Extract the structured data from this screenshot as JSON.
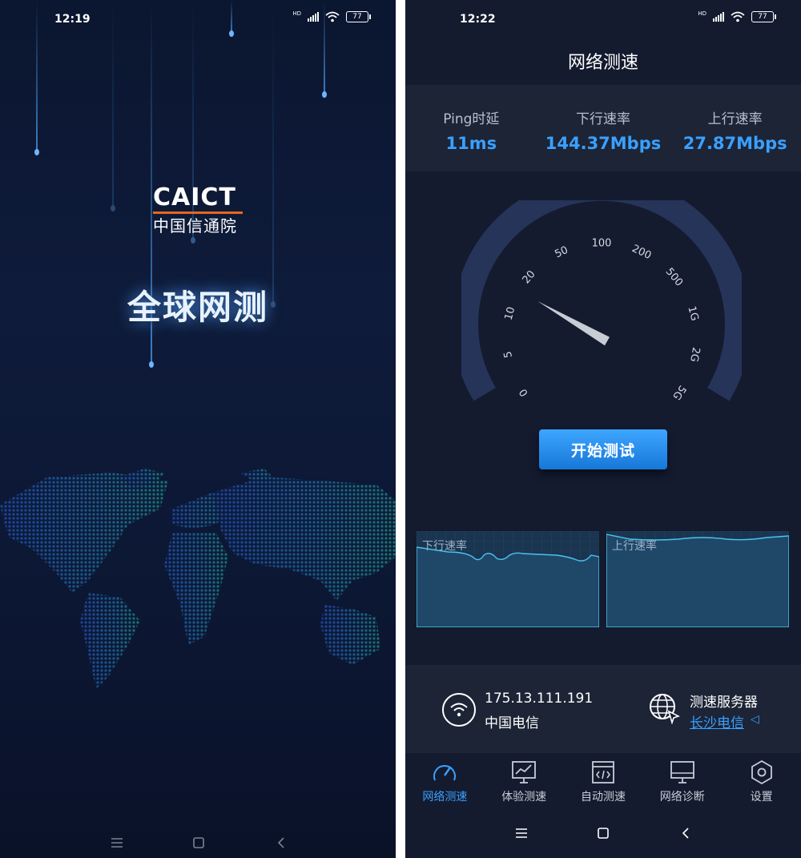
{
  "left": {
    "status": {
      "time": "12:19",
      "battery": "77",
      "hd": "HD"
    },
    "logo": {
      "en": "CAICT",
      "cn": "中国信通院"
    },
    "title": "全球网测"
  },
  "right": {
    "status": {
      "time": "12:22",
      "battery": "77",
      "hd": "HD"
    },
    "title": "网络测速",
    "metrics": [
      {
        "label": "Ping时延",
        "value": "11ms"
      },
      {
        "label": "下行速率",
        "value": "144.37Mbps"
      },
      {
        "label": "上行速率",
        "value": "27.87Mbps"
      }
    ],
    "gauge": {
      "ticks": [
        "0",
        "5",
        "10",
        "20",
        "50",
        "100",
        "200",
        "500",
        "1G",
        "2G",
        "5G"
      ],
      "needle_fraction": 0.26
    },
    "start_button": "开始测试",
    "charts": {
      "download_label": "下行速率",
      "upload_label": "上行速率"
    },
    "network": {
      "ip": "175.13.111.191",
      "isp": "中国电信"
    },
    "server": {
      "label": "测速服务器",
      "name": "长沙电信"
    },
    "tabs": [
      {
        "label": "网络测速",
        "icon": "speedometer-icon"
      },
      {
        "label": "体验测速",
        "icon": "monitor-chart-icon"
      },
      {
        "label": "自动测速",
        "icon": "code-window-icon"
      },
      {
        "label": "网络诊断",
        "icon": "monitor-icon"
      },
      {
        "label": "设置",
        "icon": "hexagon-settings-icon"
      }
    ],
    "colors": {
      "accent": "#3aa0ff",
      "panel": "#1c2436",
      "background": "#141b2f"
    }
  }
}
